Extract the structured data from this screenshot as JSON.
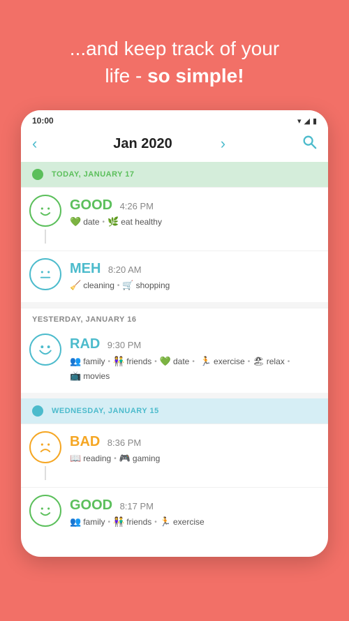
{
  "header": {
    "line1": "...and keep track of your",
    "line2_normal": "life - ",
    "line2_bold": "so simple!"
  },
  "statusBar": {
    "time": "10:00",
    "wifi": "▾",
    "signal": "▲",
    "battery": "▮"
  },
  "navigation": {
    "title": "Jan 2020",
    "prevArrow": "‹",
    "nextArrow": "›",
    "searchIcon": "🔍"
  },
  "days": [
    {
      "id": "today",
      "label": "TODAY, JANUARY 17",
      "type": "today",
      "dotColor": "green",
      "entries": [
        {
          "mood": "GOOD",
          "moodClass": "good",
          "time": "4:26 PM",
          "tags": [
            {
              "icon": "💚",
              "label": "date"
            },
            {
              "icon": "🌿",
              "label": "eat healthy"
            }
          ]
        },
        {
          "mood": "MEH",
          "moodClass": "meh",
          "time": "8:20 AM",
          "tags": [
            {
              "icon": "🧹",
              "label": "cleaning"
            },
            {
              "icon": "🛒",
              "label": "shopping"
            }
          ]
        }
      ]
    },
    {
      "id": "yesterday",
      "label": "YESTERDAY, JANUARY 16",
      "type": "yesterday",
      "dotColor": "none",
      "entries": [
        {
          "mood": "RAD",
          "moodClass": "rad",
          "time": "9:30 PM",
          "tags": [
            {
              "icon": "👥",
              "label": "family"
            },
            {
              "icon": "👫",
              "label": "friends"
            },
            {
              "icon": "💚",
              "label": "date"
            },
            {
              "icon": "🏃",
              "label": "exercise"
            },
            {
              "icon": "🏖",
              "label": "relax"
            },
            {
              "icon": "📺",
              "label": "movies"
            }
          ]
        }
      ]
    },
    {
      "id": "wednesday",
      "label": "WEDNESDAY, JANUARY 15",
      "type": "wednesday",
      "dotColor": "teal",
      "entries": [
        {
          "mood": "BAD",
          "moodClass": "bad",
          "time": "8:36 PM",
          "tags": [
            {
              "icon": "📖",
              "label": "reading"
            },
            {
              "icon": "🎮",
              "label": "gaming"
            }
          ]
        },
        {
          "mood": "GOOD",
          "moodClass": "good",
          "time": "8:17 PM",
          "tags": [
            {
              "icon": "👥",
              "label": "family"
            },
            {
              "icon": "👫",
              "label": "friends"
            },
            {
              "icon": "🏃",
              "label": "exercise"
            }
          ]
        }
      ]
    }
  ]
}
